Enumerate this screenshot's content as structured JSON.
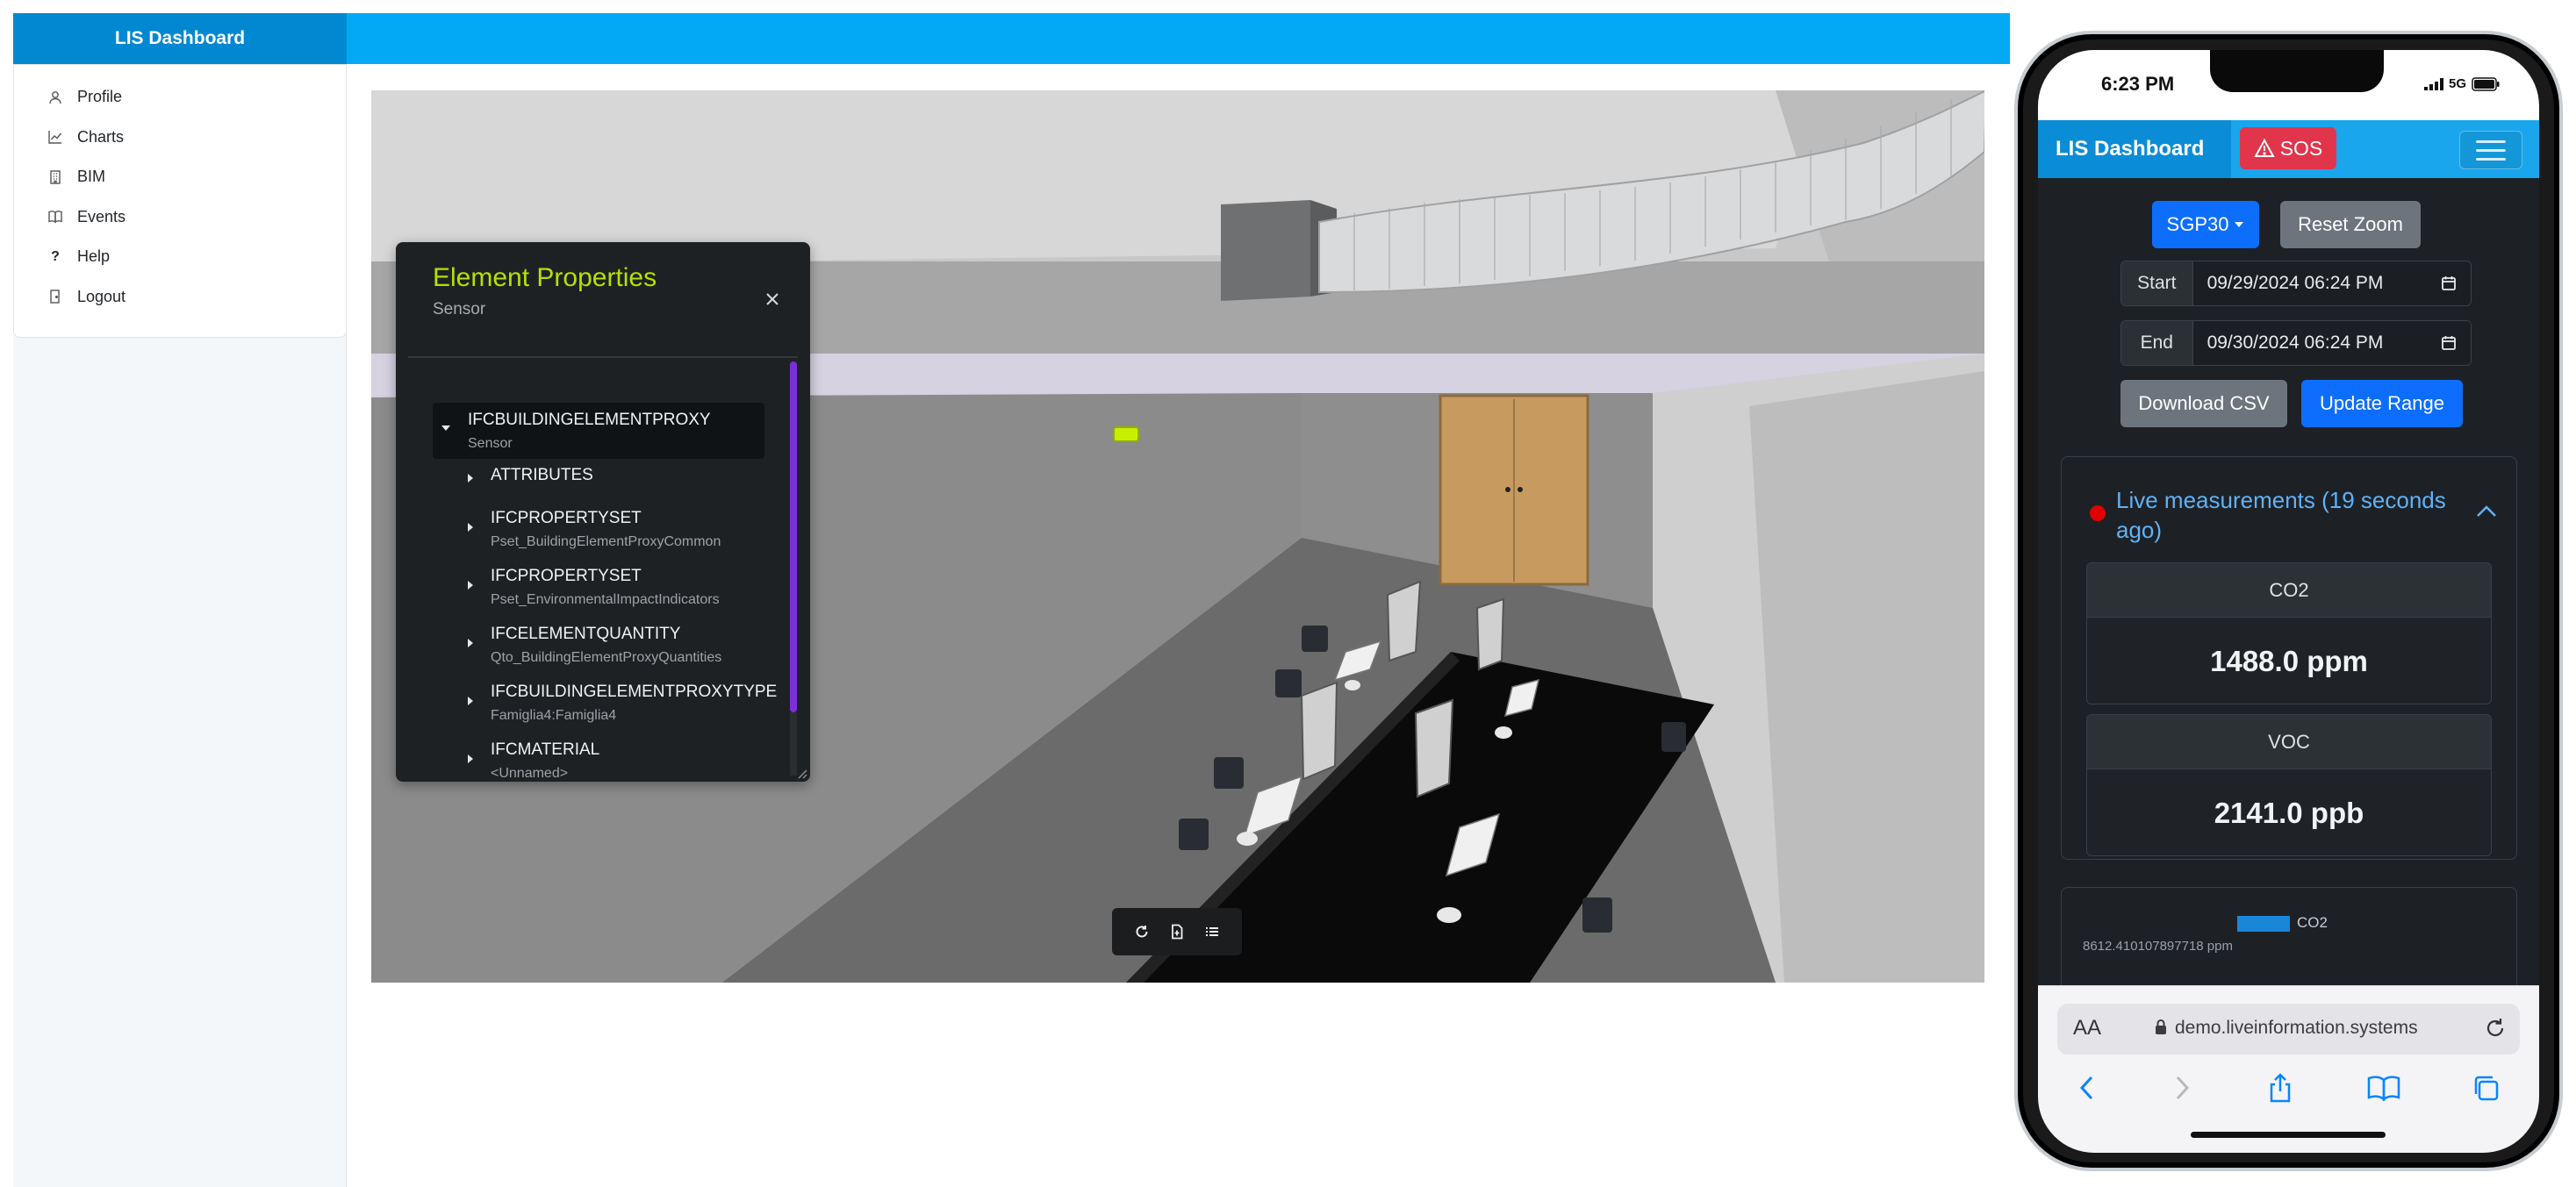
{
  "app": {
    "brand": "LIS Dashboard"
  },
  "sidebar": {
    "items": [
      {
        "label": "Profile",
        "icon": "user-icon"
      },
      {
        "label": "Charts",
        "icon": "chart-line-icon"
      },
      {
        "label": "BIM",
        "icon": "building-icon"
      },
      {
        "label": "Events",
        "icon": "book-icon"
      },
      {
        "label": "Help",
        "icon": "question-icon"
      },
      {
        "label": "Logout",
        "icon": "door-icon"
      }
    ]
  },
  "viewer": {
    "properties_panel": {
      "title": "Element Properties",
      "subtitle": "Sensor",
      "root": {
        "title": "IFCBUILDINGELEMENTPROXY",
        "subtitle": "Sensor"
      },
      "children": [
        {
          "title": "ATTRIBUTES",
          "subtitle": ""
        },
        {
          "title": "IFCPROPERTYSET",
          "subtitle": "Pset_BuildingElementProxyCommon"
        },
        {
          "title": "IFCPROPERTYSET",
          "subtitle": "Pset_EnvironmentalImpactIndicators"
        },
        {
          "title": "IFCELEMENTQUANTITY",
          "subtitle": "Qto_BuildingElementProxyQuantities"
        },
        {
          "title": "IFCBUILDINGELEMENTPROXYTYPE",
          "subtitle": "Famiglia4:Famiglia4"
        },
        {
          "title": "IFCMATERIAL",
          "subtitle": "<Unnamed>"
        }
      ]
    },
    "toolbar": {
      "buttons": [
        "reset-view-icon",
        "export-file-icon",
        "list-icon"
      ]
    },
    "colors": {
      "accent_title": "#b6e000",
      "scrollbar": "#7a30d9"
    }
  },
  "phone": {
    "status": {
      "time": "6:23 PM",
      "network": "5G"
    },
    "nav": {
      "brand": "LIS Dashboard",
      "sos_label": "SOS"
    },
    "controls": {
      "device_label": "SGP30",
      "reset_zoom_label": "Reset Zoom",
      "start_label": "Start",
      "start_value": "09/29/2024 06:24 PM",
      "end_label": "End",
      "end_value": "09/30/2024 06:24 PM",
      "download_label": "Download CSV",
      "update_label": "Update Range"
    },
    "live": {
      "title": "Live measurements (19 seconds ago)",
      "measurements": [
        {
          "name": "CO2",
          "value": "1488.0 ppm"
        },
        {
          "name": "VOC",
          "value": "2141.0 ppb"
        }
      ]
    },
    "chart": {
      "legend": "CO2",
      "ytick": "8612.410107897718 ppm"
    },
    "safari": {
      "aa_label": "AA",
      "url": "demo.liveinformation.systems"
    },
    "colors": {
      "nav": "#0b8cd6",
      "sos": "#e1354c",
      "primary": "#0d6efd",
      "secondary": "#6c757d",
      "live_title": "#5fb2f7",
      "live_dot": "#e00000"
    }
  }
}
